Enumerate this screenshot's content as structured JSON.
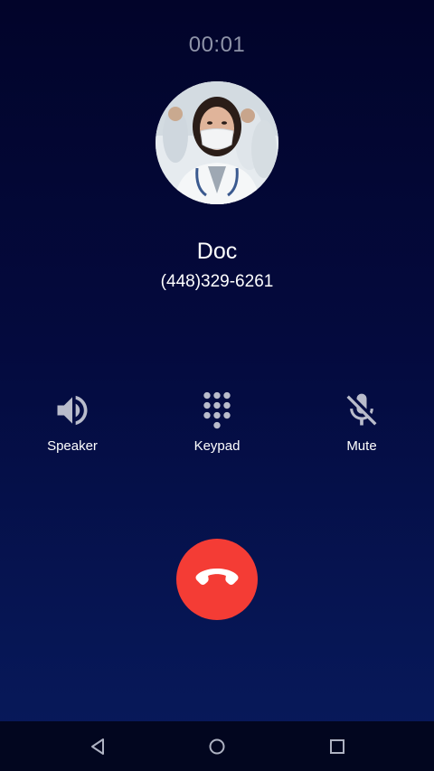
{
  "call": {
    "timer": "00:01",
    "contact_name": "Doc",
    "contact_number": "(448)329-6261"
  },
  "controls": [
    {
      "label": "Speaker",
      "icon": "speaker-icon"
    },
    {
      "label": "Keypad",
      "icon": "dialpad-icon"
    },
    {
      "label": "Mute",
      "icon": "mic-off-icon"
    }
  ],
  "end_call": {
    "icon": "end-call-icon",
    "color": "#f43c35"
  },
  "navbar": {
    "buttons": [
      "back-icon",
      "home-icon",
      "recents-icon"
    ]
  },
  "colors": {
    "background_top": "#02042a",
    "background_bottom": "#081a5c",
    "timer_text": "#8e93a8",
    "control_icon": "#b9bccb"
  }
}
